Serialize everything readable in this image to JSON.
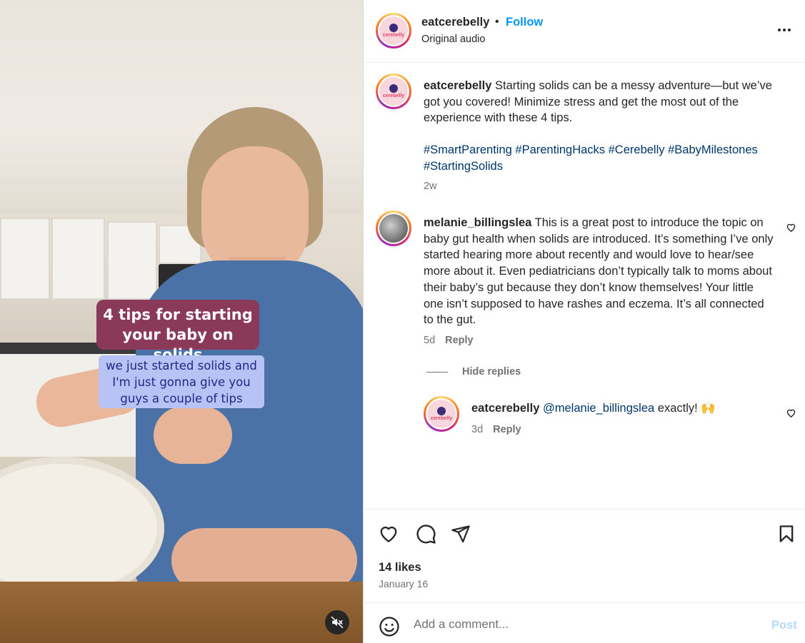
{
  "post": {
    "username": "eatcerebelly",
    "follow_label": "Follow",
    "separator": "•",
    "audio": "Original audio",
    "avatar_logo_text": "cerebelly"
  },
  "media": {
    "overlay_title": "4 tips for starting your baby on solids",
    "overlay_caption": "we just started solids and I'm just gonna give you guys a couple of tips",
    "mute_icon": "muted-speaker-icon"
  },
  "caption": {
    "username": "eatcerebelly",
    "text": "Starting solids can be a messy adventure—but we’ve got you covered! Minimize stress and get the most out of the experience with these 4 tips.",
    "hashtags_line1": "#SmartParenting #ParentingHacks #Cerebelly #BabyMilestones",
    "hashtags_line2": "#StartingSolids",
    "time": "2w"
  },
  "comments": [
    {
      "username": "melanie_billingslea",
      "text": "This is a great post to introduce the topic on baby gut health when solids are introduced. It’s something I’ve only started hearing more about recently and would love to hear/see more about it. Even pediatricians don’t typically talk to moms about their baby’s gut because they don’t know themselves! Your little one isn’t supposed to have rashes and eczema. It’s all connected to the gut.",
      "time": "5d",
      "reply_label": "Reply",
      "hide_replies_label": "Hide replies",
      "replies": [
        {
          "username": "eatcerebelly",
          "mention": "@melanie_billingslea",
          "text": "exactly! 🙌",
          "time": "3d",
          "reply_label": "Reply"
        }
      ]
    }
  ],
  "actions": {
    "likes": "14 likes",
    "date": "January 16"
  },
  "composer": {
    "placeholder": "Add a comment...",
    "post_label": "Post"
  },
  "colors": {
    "follow_blue": "#0095f6",
    "hashtag_blue": "#00376b",
    "post_disabled": "#b3dbff",
    "overlay_title_bg": "#8a3a58",
    "overlay_caption_bg": "#b7c2f5"
  }
}
